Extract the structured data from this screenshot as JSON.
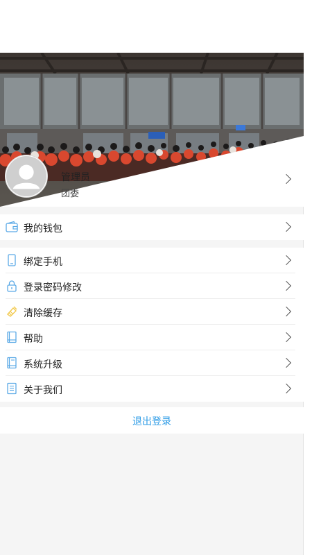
{
  "profile": {
    "name": "管理员",
    "org": "团委"
  },
  "wallet_group": [
    {
      "label": "我的钱包",
      "icon": "wallet-icon"
    }
  ],
  "settings_group": [
    {
      "label": "绑定手机",
      "icon": "phone-icon"
    },
    {
      "label": "登录密码修改",
      "icon": "lock-icon"
    },
    {
      "label": "清除缓存",
      "icon": "broom-icon"
    },
    {
      "label": "帮助",
      "icon": "help-book-icon"
    },
    {
      "label": "系统升级",
      "icon": "upgrade-book-icon"
    },
    {
      "label": "关于我们",
      "icon": "document-icon"
    }
  ],
  "logout_label": "退出登录",
  "colors": {
    "accent": "#2c9be6",
    "icon_blue": "#5aa9e6",
    "icon_yellow": "#f2c94c",
    "background": "#f5f5f5"
  }
}
